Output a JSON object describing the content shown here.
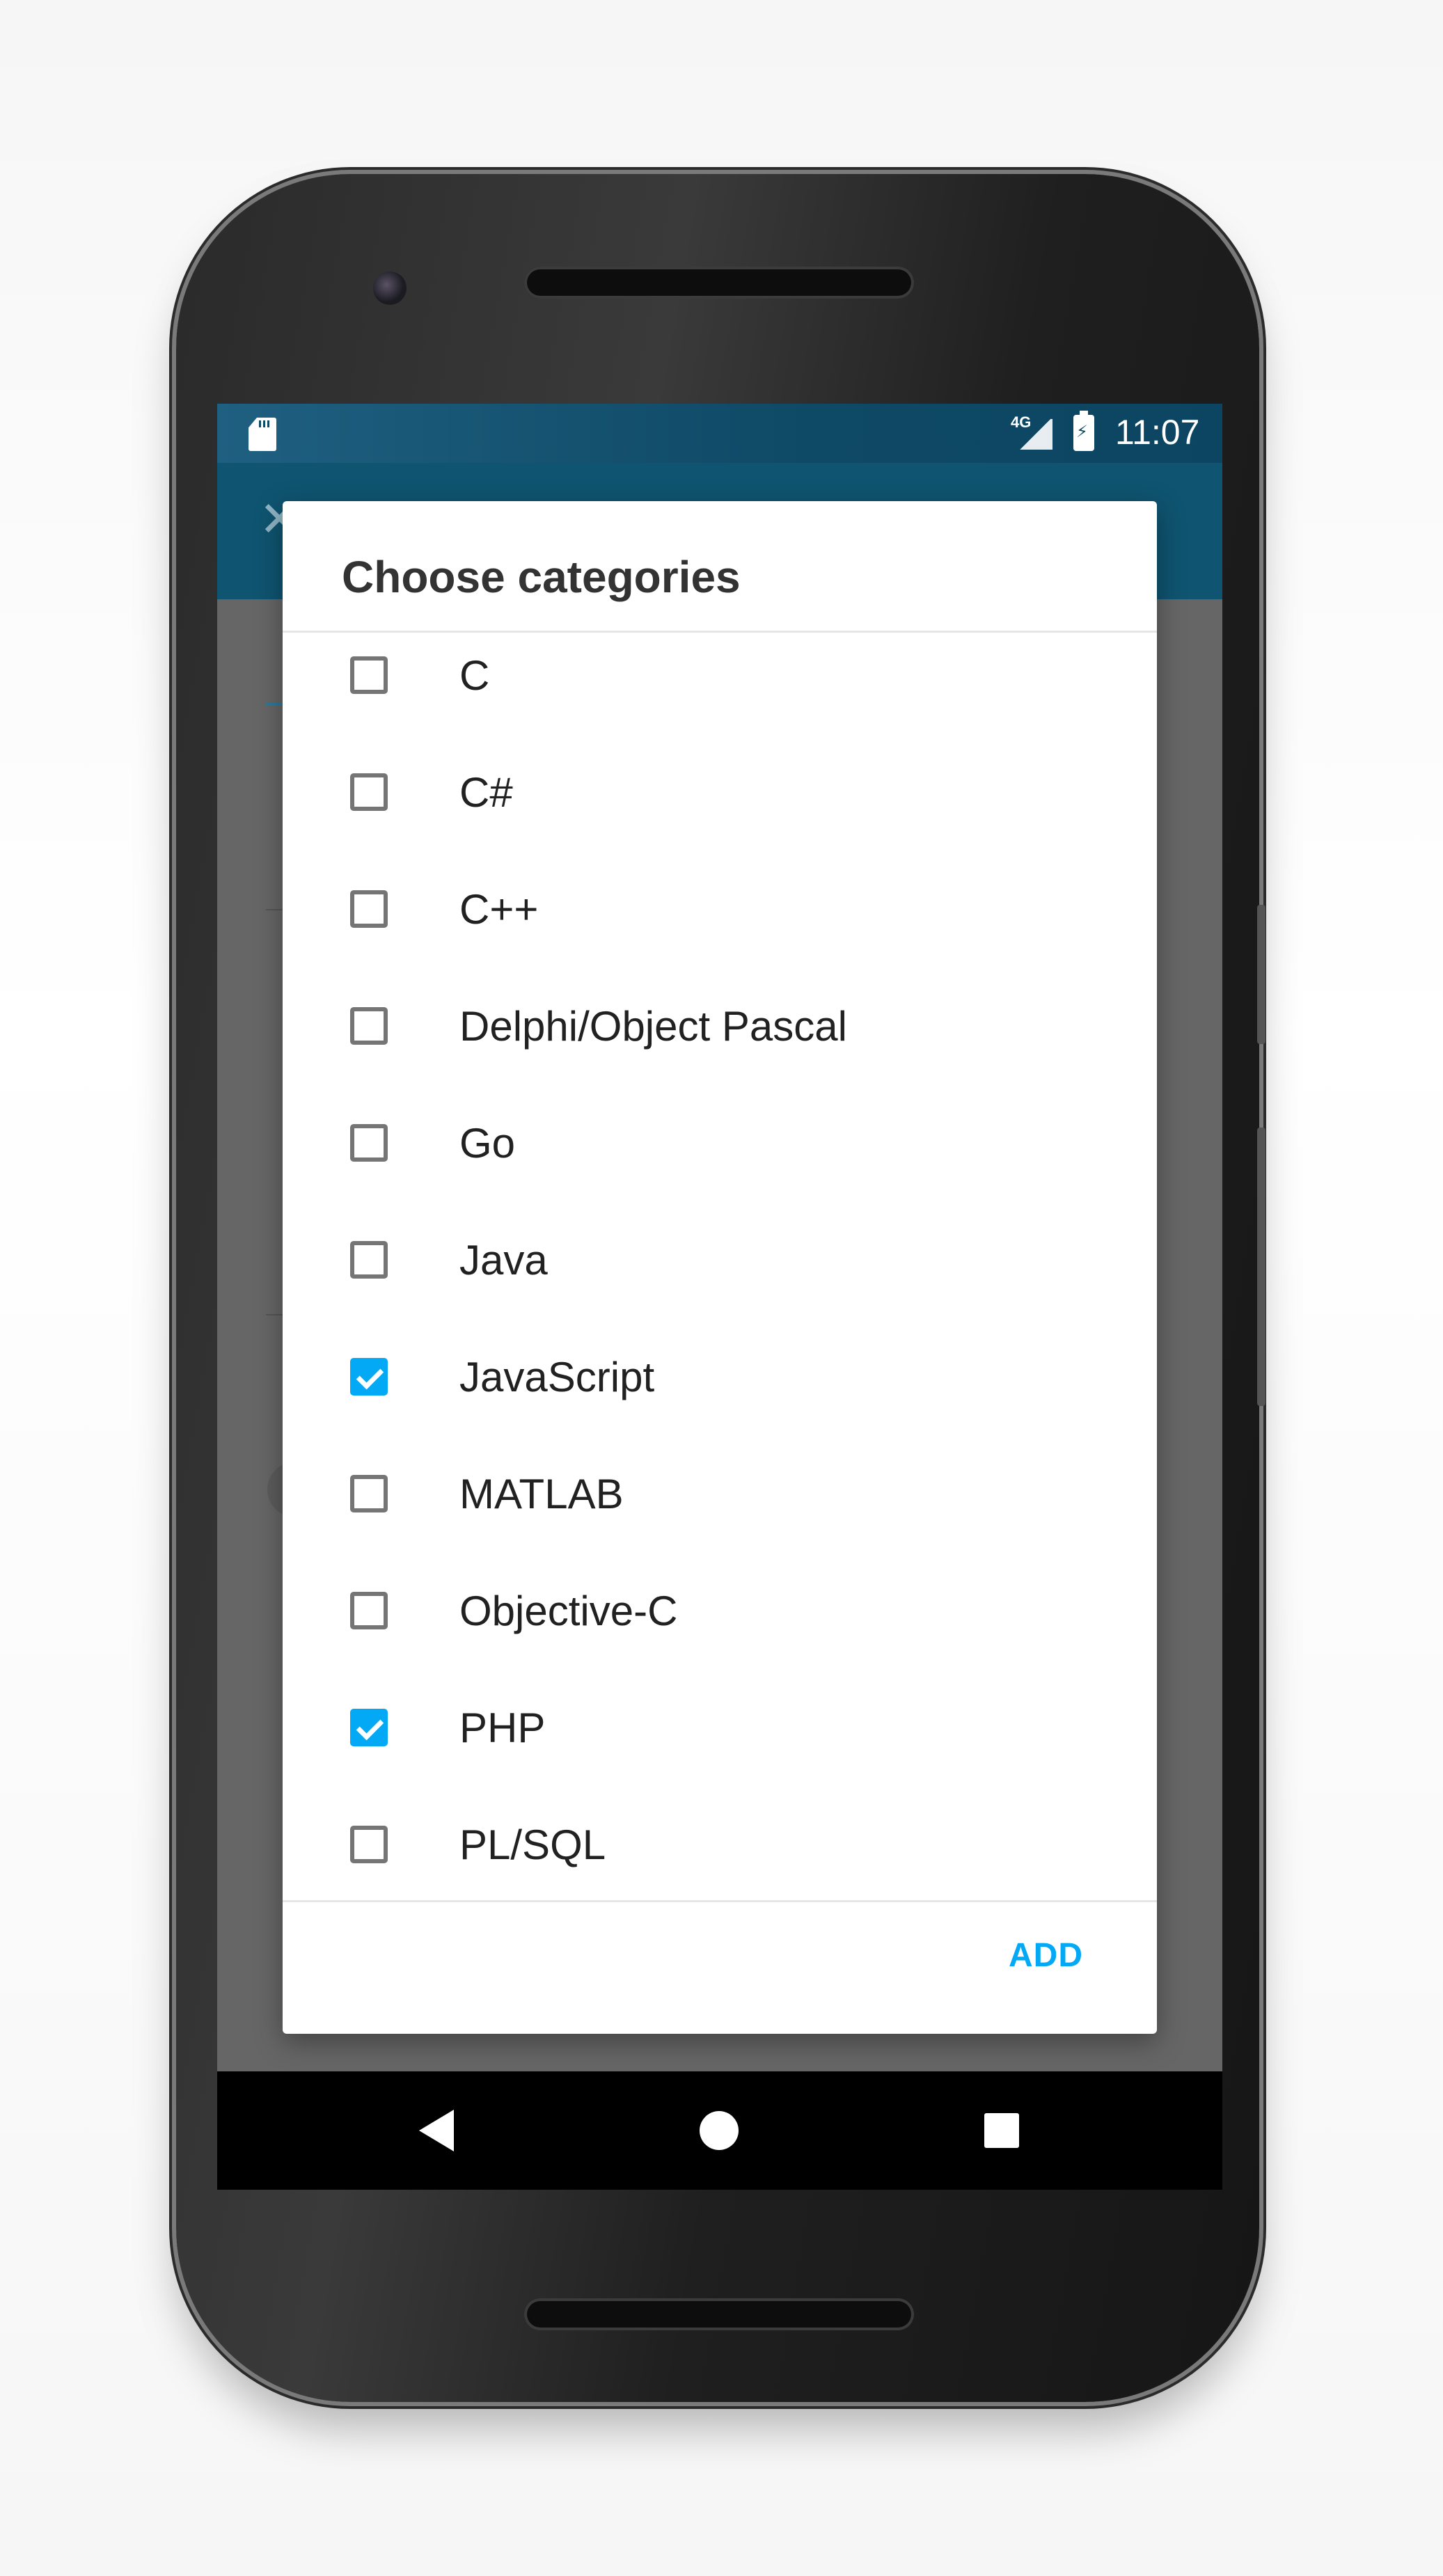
{
  "status_bar": {
    "network": "4G",
    "time": "11:07"
  },
  "dialog": {
    "title": "Choose categories",
    "items": [
      {
        "label": "C",
        "checked": false
      },
      {
        "label": "C#",
        "checked": false
      },
      {
        "label": "C++",
        "checked": false
      },
      {
        "label": "Delphi/Object Pascal",
        "checked": false
      },
      {
        "label": "Go",
        "checked": false
      },
      {
        "label": "Java",
        "checked": false
      },
      {
        "label": "JavaScript",
        "checked": true
      },
      {
        "label": "MATLAB",
        "checked": false
      },
      {
        "label": "Objective-C",
        "checked": false
      },
      {
        "label": "PHP",
        "checked": true
      },
      {
        "label": "PL/SQL",
        "checked": false
      }
    ],
    "add_label": "ADD"
  },
  "colors": {
    "accent": "#03a9f4",
    "status_bar": "#0e4965",
    "app_bar": "#0f5470",
    "scrim": "#666666"
  },
  "icons": {
    "sd_card": "sd-card-icon",
    "signal": "signal-4g-icon",
    "battery": "battery-charging-icon",
    "back": "nav-back-icon",
    "home": "nav-home-icon",
    "recents": "nav-recents-icon"
  }
}
